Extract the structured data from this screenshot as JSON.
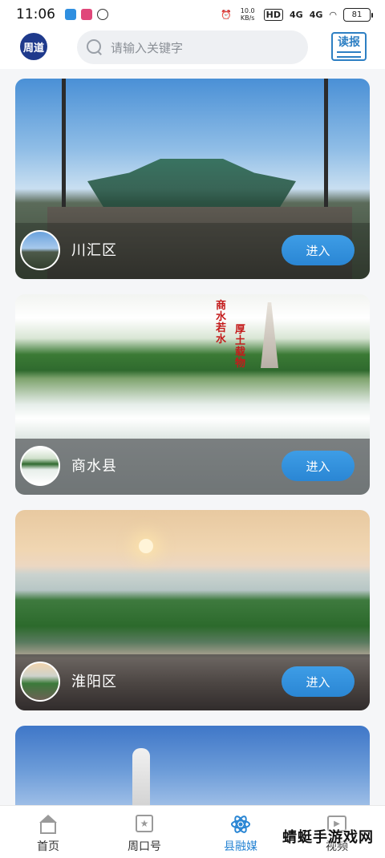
{
  "status_bar": {
    "time": "11:06",
    "speed": "10.0 KB/s",
    "hd": "HD",
    "net1": "4G",
    "net2": "4G",
    "battery": "81"
  },
  "header": {
    "logo_text": "周道",
    "search_placeholder": "请输入关键字",
    "read_button_label": "读报"
  },
  "cards": [
    {
      "title": "川汇区",
      "enter_label": "进入"
    },
    {
      "title": "商水县",
      "enter_label": "进入",
      "banner_text_1": "商水若水",
      "banner_text_2": "厚土载物"
    },
    {
      "title": "淮阳区",
      "enter_label": "进入"
    },
    {
      "title": "",
      "enter_label": ""
    }
  ],
  "bottom_nav": {
    "items": [
      {
        "label": "首页",
        "icon": "home-icon",
        "active": false
      },
      {
        "label": "周口号",
        "icon": "star-icon",
        "active": false
      },
      {
        "label": "县融媒",
        "icon": "atom-icon",
        "active": true
      },
      {
        "label": "视频",
        "icon": "video-icon",
        "active": false
      }
    ]
  },
  "watermark": "蜻蜓手游戏网",
  "colors": {
    "accent": "#2a86d4",
    "header_bg": "#ffffff",
    "search_bg": "#eef0f3",
    "logo_bg": "#1f3a8c"
  }
}
